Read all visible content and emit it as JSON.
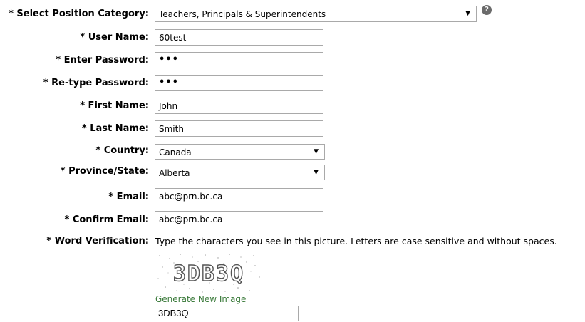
{
  "form": {
    "position_category": {
      "label": "* Select Position Category:",
      "value": "Teachers, Principals & Superintendents",
      "arrow": "▼",
      "help_icon": "?"
    },
    "username": {
      "label": "* User Name:",
      "value": "60test"
    },
    "password": {
      "label": "* Enter Password:",
      "value": "•••"
    },
    "retype_password": {
      "label": "* Re-type Password:",
      "value": "•••"
    },
    "first_name": {
      "label": "* First Name:",
      "value": "John"
    },
    "last_name": {
      "label": "* Last Name:",
      "value": "Smith"
    },
    "country": {
      "label": "* Country:",
      "value": "Canada",
      "arrow": "▼"
    },
    "province": {
      "label": "* Province/State:",
      "value": "Alberta",
      "arrow": "▼"
    },
    "email": {
      "label": "* Email:",
      "value": "abc@prn.bc.ca"
    },
    "confirm_email": {
      "label": "* Confirm Email:",
      "value": "abc@prn.bc.ca"
    },
    "word_verification": {
      "label": "* Word Verification:",
      "instructions": "Type the characters you see in this picture. Letters are case sensitive and without spaces.",
      "captcha_text": "3DB3Q",
      "generate_link": "Generate New Image",
      "value": "3DB3Q"
    }
  },
  "colors": {
    "link": "#3a7a3a",
    "border": "#a9a9a9",
    "help_icon_bg": "#6b6b6b"
  },
  "icons": {
    "help": "help-circle-icon",
    "dropdown": "chevron-down-icon"
  }
}
